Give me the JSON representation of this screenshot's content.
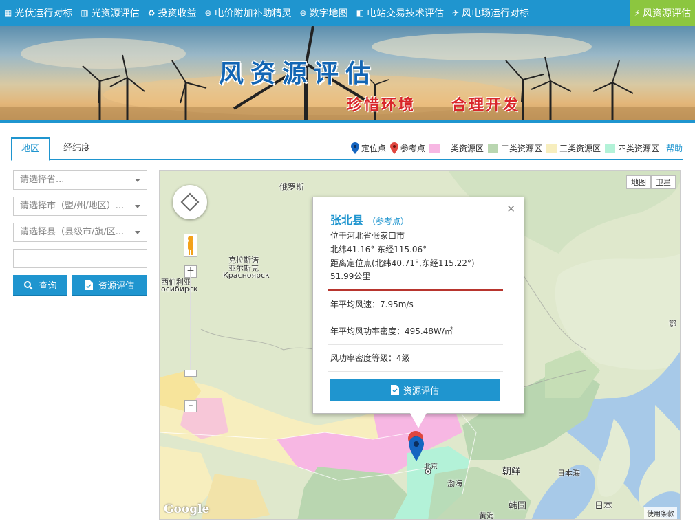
{
  "nav": {
    "items": [
      {
        "label": "光伏运行对标",
        "icon": "grid-icon",
        "glyph": "▦"
      },
      {
        "label": "光资源评估",
        "icon": "bar-chart-icon",
        "glyph": "▥"
      },
      {
        "label": "投资收益",
        "icon": "recycle-icon",
        "glyph": "♻"
      },
      {
        "label": "电价附加补助精灵",
        "icon": "yuan-icon",
        "glyph": "⊕"
      },
      {
        "label": "数字地图",
        "icon": "globe-icon",
        "glyph": "⊕"
      },
      {
        "label": "电站交易技术评估",
        "icon": "chat-icon",
        "glyph": "◧"
      },
      {
        "label": "风电场运行对标",
        "icon": "plane-icon",
        "glyph": "✈"
      },
      {
        "label": "风资源评估",
        "icon": "bolt-icon",
        "glyph": "⚡",
        "active": true
      }
    ]
  },
  "banner": {
    "title": "风资源评估",
    "slogan_left": "珍惜环境",
    "slogan_right": "合理开发"
  },
  "tabs": {
    "region": "地区",
    "latlng": "经纬度"
  },
  "legend": {
    "locate_point": "定位点",
    "ref_point": "参考点",
    "class1": "一类资源区",
    "class2": "二类资源区",
    "class3": "三类资源区",
    "class4": "四类资源区",
    "help": "帮助",
    "colors": {
      "locate": "#1565c0",
      "ref": "#e0463f",
      "class1": "#f7b7e3",
      "class2": "#b9d6b0",
      "class3": "#f7eebe",
      "class4": "#b3f2d8"
    }
  },
  "form": {
    "province_placeholder": "请选择省...",
    "city_placeholder": "请选择市（盟/州/地区）...",
    "county_placeholder": "请选择县（县级市/旗/区...",
    "query_label": "查询",
    "assess_label": "资源评估"
  },
  "map": {
    "type_map": "地图",
    "type_satellite": "卫星",
    "labels": {
      "russia": "俄罗斯",
      "krasnoyarsk_cn": "克拉斯诺",
      "krasnoyarsk_cn2": "亚尔斯克",
      "krasnoyarsk_ru": "Красноярск",
      "novosibirsk_cn": "西伯利亚",
      "novosibirsk_ru": "осибирск",
      "korea": "朝鲜",
      "south_korea": "韩国",
      "japan": "日本",
      "sea_of_japan": "日本海",
      "bohai": "渤海",
      "yellow_sea": "黄海",
      "beijing": "北京",
      "okhotsk": "鄂"
    },
    "google": "Google",
    "terms": "使用条款"
  },
  "popup": {
    "name": "张北县",
    "tag": "（参考点）",
    "location": "位于河北省张家口市",
    "coords": "北纬41.16° 东经115.06°",
    "distance_desc": "距离定位点(北纬40.71°,东经115.22°)",
    "distance": "51.99公里",
    "wind_speed": "年平均风速：7.95m/s",
    "power_density": "年平均风功率密度：495.48W/㎡",
    "density_grade": "风功率密度等级：4级",
    "button": "资源评估"
  }
}
